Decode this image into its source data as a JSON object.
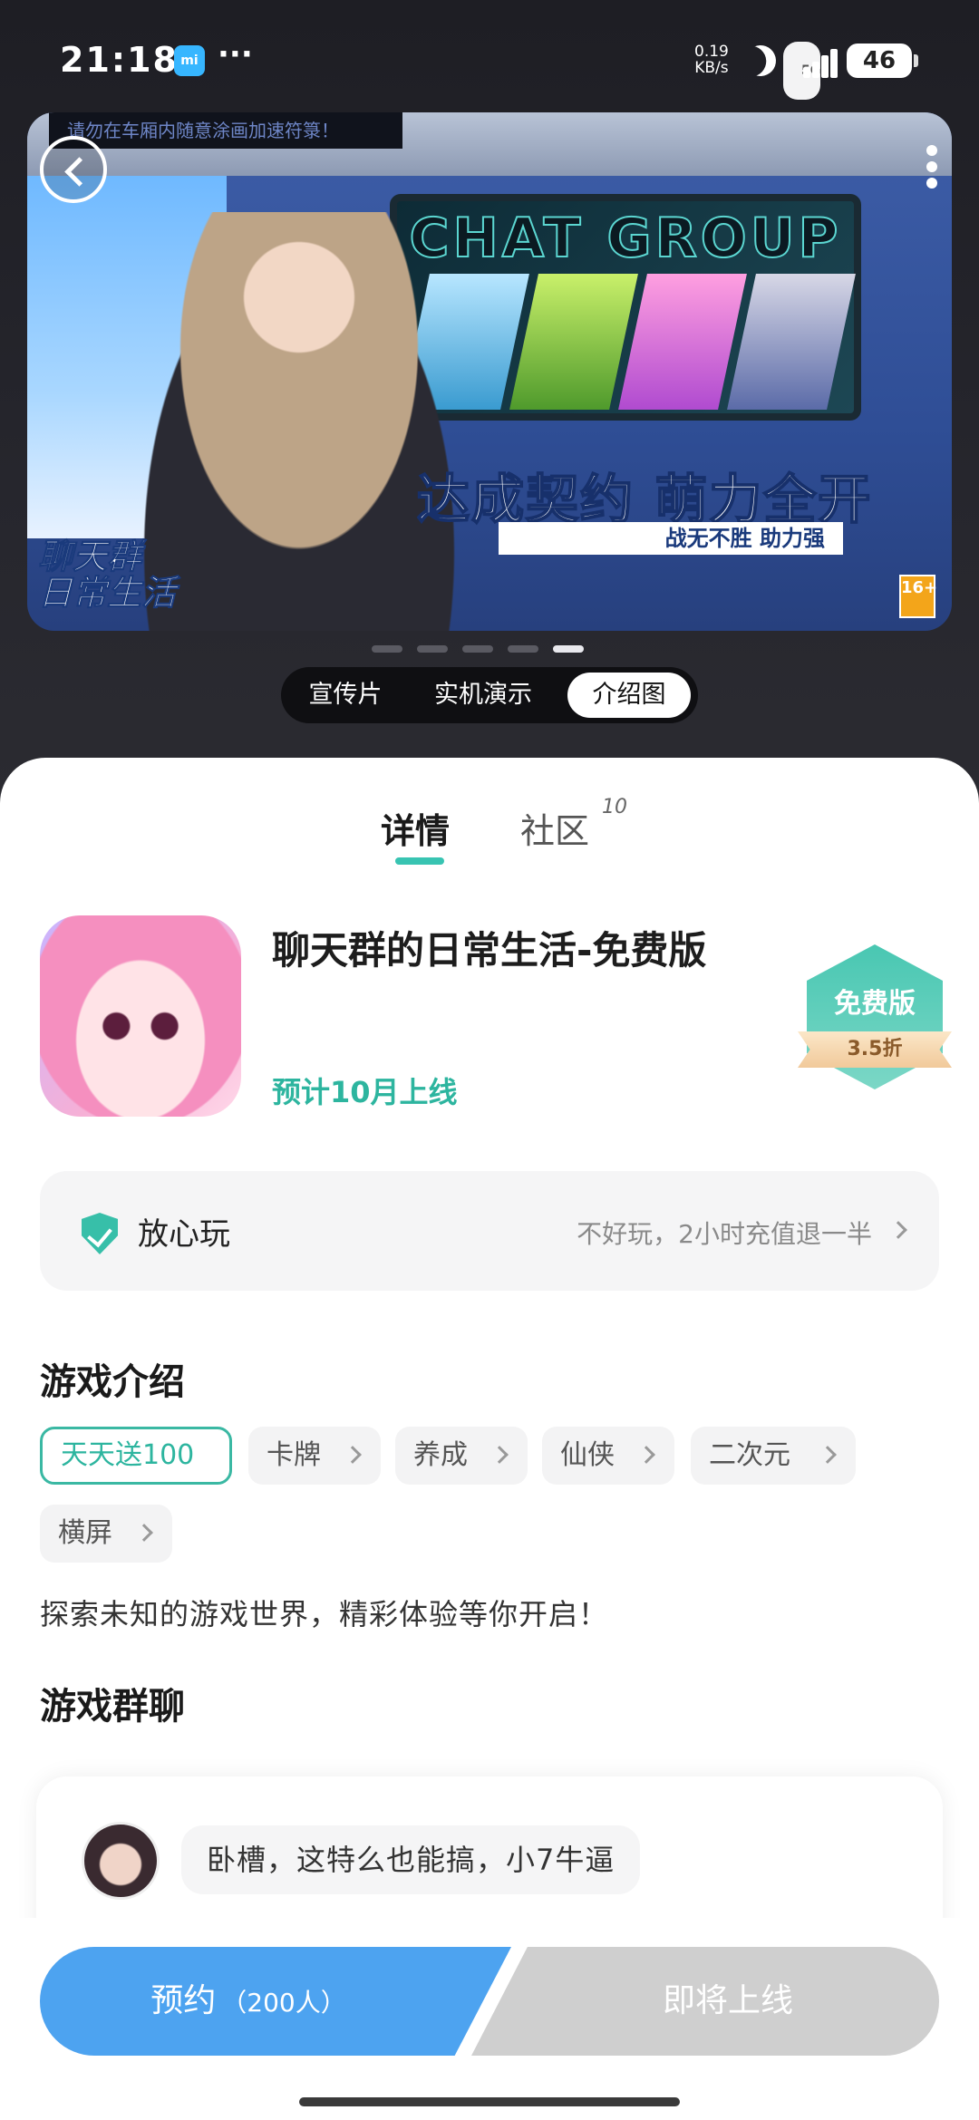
{
  "status_bar": {
    "time": "21:18",
    "net_speed_value": "0.19",
    "net_speed_unit": "KB/s",
    "network": "5G",
    "battery": "46"
  },
  "banner": {
    "notice": "请勿在车厢内随意涂画加速符箓！",
    "screen_title": "CHAT GROUP",
    "slogan": "达成契约 萌力全开",
    "slogan_sub": "战无不胜 助力强",
    "logo_text_line1": "聊天群",
    "logo_text_line2": "日常生活",
    "age_rating": "16+"
  },
  "media_tabs": [
    {
      "label": "宣传片",
      "active": false
    },
    {
      "label": "实机演示",
      "active": false
    },
    {
      "label": "介绍图",
      "active": true
    }
  ],
  "carousel": {
    "count": 5,
    "active_index": 4
  },
  "page_tabs": [
    {
      "label": "详情",
      "active": true
    },
    {
      "label": "社区",
      "active": false,
      "badge": "10"
    }
  ],
  "app": {
    "name": "聊天群的日常生活-免费版",
    "release": "预计10月上线",
    "badge_label": "免费版",
    "badge_discount": "3.5折"
  },
  "assurance": {
    "title": "放心玩",
    "description": "不好玩，2小时充值退一半"
  },
  "intro": {
    "title": "游戏介绍",
    "tags": [
      "天天送100",
      "卡牌",
      "养成",
      "仙侠",
      "二次元",
      "横屏"
    ],
    "text": "探索未知的游戏世界，精彩体验等你开启！"
  },
  "group_chat": {
    "title": "游戏群聊",
    "message": "卧槽，这特么也能搞，小7牛逼"
  },
  "actions": {
    "reserve_label": "预约",
    "reserve_count": "（200人）",
    "soon_label": "即将上线"
  },
  "colors": {
    "accent": "#38c4b2",
    "reserve": "#4da3f0",
    "disabled": "#cfcfcf"
  }
}
